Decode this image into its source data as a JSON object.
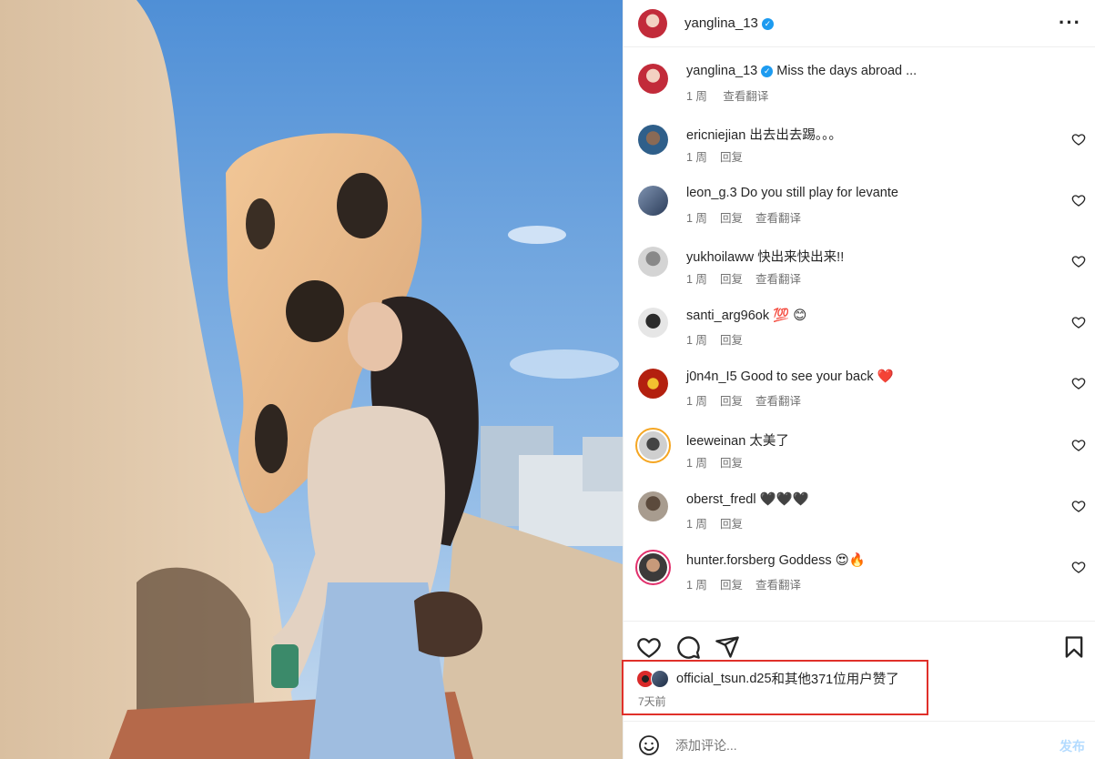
{
  "colors": {
    "accent": "#0095f6",
    "verified": "#1d9bf0",
    "highlight_box": "#e0302a",
    "heart_red": "#e0245e"
  },
  "post": {
    "author": "yanglina_13",
    "author_verified": true,
    "caption": "Miss the days abroad ...",
    "caption_time": "1 周",
    "caption_translate": "查看翻译",
    "image_description_icon": "photo"
  },
  "comments": [
    {
      "user": "ericniejian",
      "text": "出去出去踢。。。",
      "time": "1 周",
      "reply": "回复",
      "translate": ""
    },
    {
      "user": "leon_g.3",
      "text": "Do you still play for levante",
      "time": "1 周",
      "reply": "回复",
      "translate": "查看翻译"
    },
    {
      "user": "yukhoilaww",
      "text": "快出来快出来!!",
      "time": "1 周",
      "reply": "回复",
      "translate": "查看翻译"
    },
    {
      "user": "santi_arg96ok",
      "text": "💯 😊",
      "time": "1 周",
      "reply": "回复",
      "translate": ""
    },
    {
      "user": "j0n4n_I5",
      "text": "Good to see your back ❤️",
      "time": "1 周",
      "reply": "回复",
      "translate": "查看翻译"
    },
    {
      "user": "leeweinan",
      "text": "太美了",
      "time": "1 周",
      "reply": "回复",
      "translate": ""
    },
    {
      "user": "oberst_fredl",
      "text": "🖤🖤🖤",
      "time": "1 周",
      "reply": "回复",
      "translate": ""
    },
    {
      "user": "hunter.forsberg",
      "text": "Goddess 😍🔥",
      "time": "1 周",
      "reply": "回复",
      "translate": "查看翻译"
    }
  ],
  "likes": {
    "text_user": "official_tsun.d25",
    "text_rest": "和其他371位用户赞了",
    "time": "7天前"
  },
  "add_comment": {
    "placeholder": "添加评论...",
    "post_label": "发布"
  }
}
